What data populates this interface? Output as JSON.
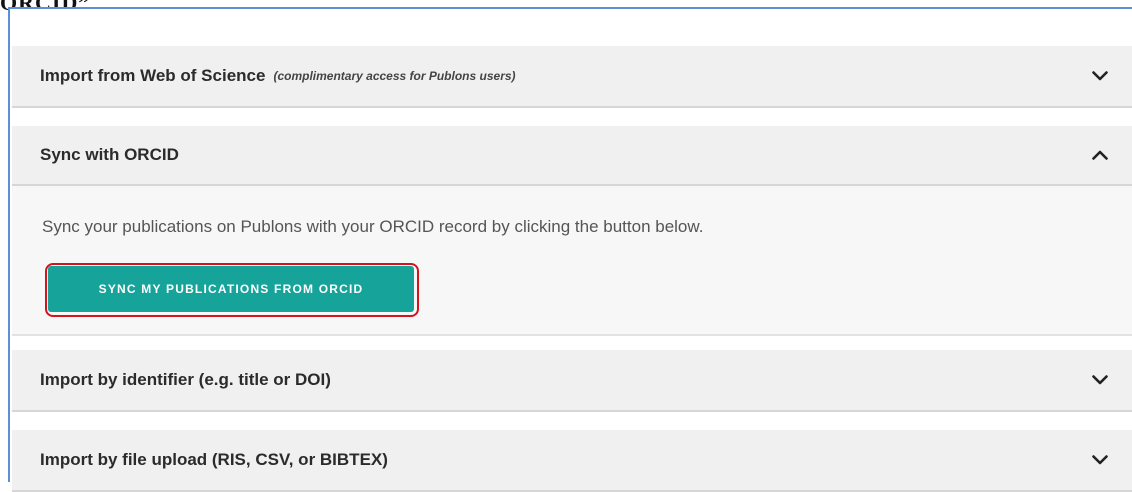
{
  "top_clipped_text": "ORCID”",
  "panels": [
    {
      "title": "Import from Web of Science",
      "note": "(complimentary access for Publons users)",
      "expanded": false,
      "chevron": "chevron-down-icon"
    },
    {
      "title": "Sync with ORCID",
      "note": "",
      "expanded": true,
      "chevron": "chevron-up-icon",
      "body_text": "Sync your publications on Publons with your ORCID record by clicking the button below.",
      "button_label": "SYNC MY PUBLICATIONS FROM ORCID"
    },
    {
      "title": "Import by identifier (e.g. title or DOI)",
      "note": "",
      "expanded": false,
      "chevron": "chevron-down-icon"
    },
    {
      "title": "Import by file upload (RIS, CSV, or BIBTEX)",
      "note": "",
      "expanded": false,
      "chevron": "chevron-down-icon"
    }
  ],
  "colors": {
    "accent_button": "#16a39a",
    "highlight_outline": "#d4141c",
    "frame_border": "#5b8fd6"
  }
}
